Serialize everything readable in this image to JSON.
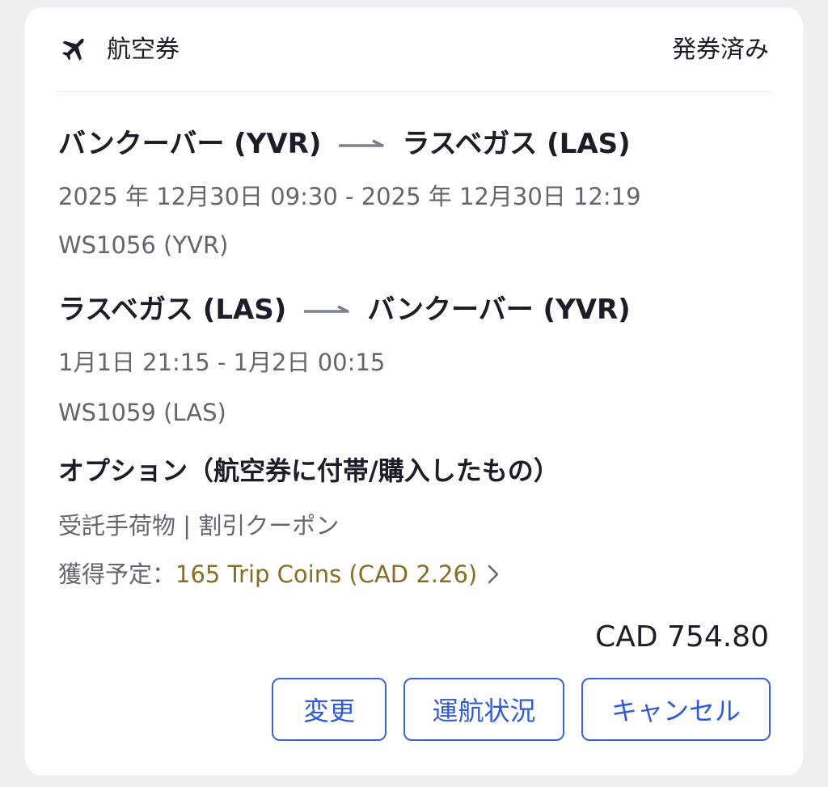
{
  "header": {
    "title": "航空券",
    "status": "発券済み"
  },
  "segments": [
    {
      "from": "バンクーバー (YVR)",
      "to": "ラスベガス (LAS)",
      "time": "2025 年 12月30日 09:30 - 2025 年 12月30日 12:19",
      "flight": "WS1056 (YVR)"
    },
    {
      "from": "ラスベガス (LAS)",
      "to": "バンクーバー (YVR)",
      "time": "1月1日 21:15 - 1月2日 00:15",
      "flight": "WS1059 (LAS)"
    }
  ],
  "options": {
    "title": "オプション（航空券に付帯/購入したもの）",
    "items": "受託手荷物 | 割引クーポン",
    "coins_label": "獲得予定：",
    "coins_value": "165 Trip Coins (CAD 2.26)"
  },
  "price": "CAD 754.80",
  "buttons": {
    "change": "変更",
    "status": "運航状況",
    "cancel": "キャンセル"
  },
  "colors": {
    "accent": "#2f5bd6",
    "coins": "#8a6d25",
    "text": "#1b1e29",
    "muted": "#62666f"
  },
  "icons": {
    "header": "plane-icon",
    "route": "arrow-right-icon",
    "coins": "chevron-right-icon"
  }
}
